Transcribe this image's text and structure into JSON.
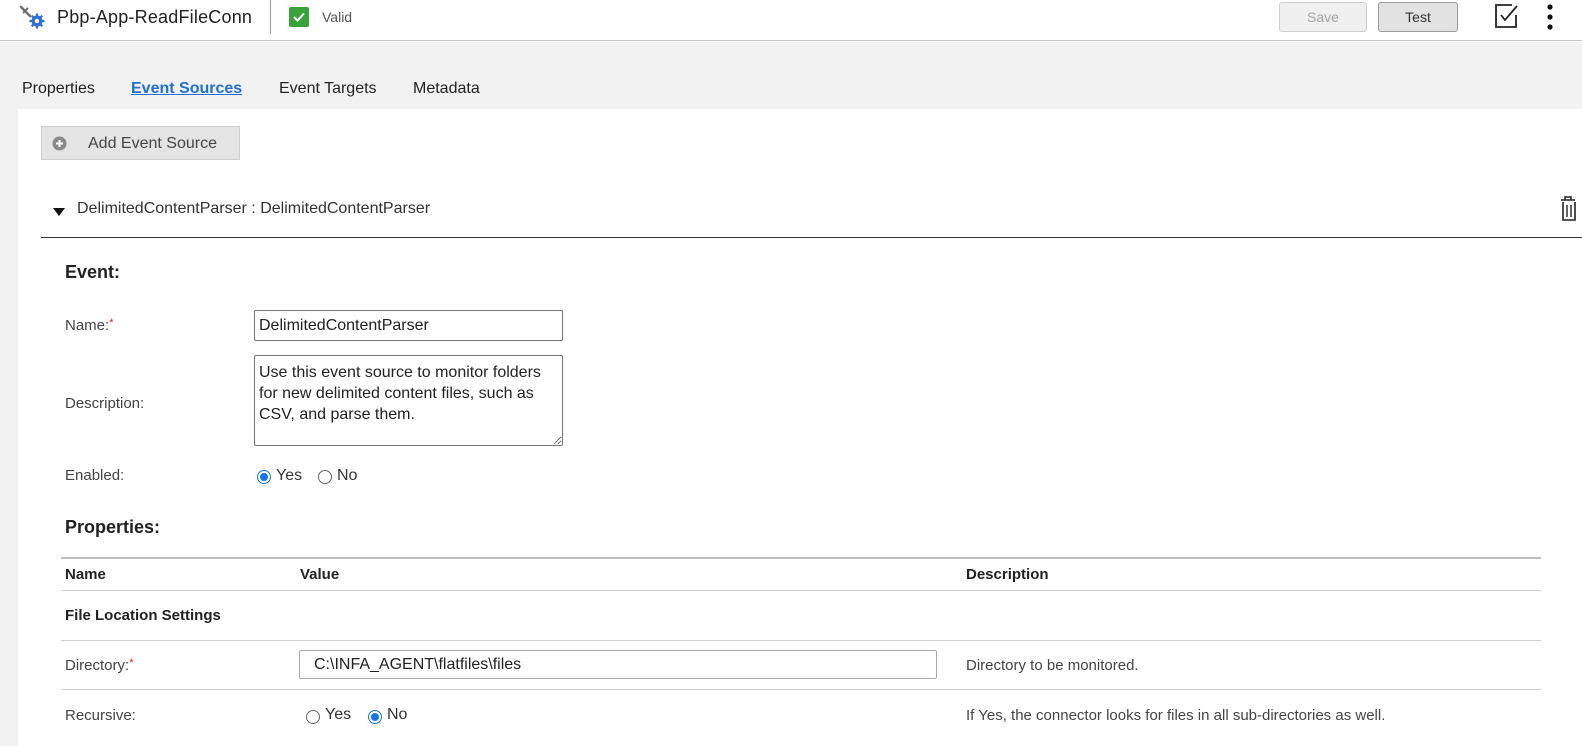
{
  "header": {
    "app_title": "Pbp-App-ReadFileConn",
    "status_text": "Valid",
    "save_label": "Save",
    "test_label": "Test"
  },
  "tabs": [
    {
      "label": "Properties",
      "active": false
    },
    {
      "label": "Event Sources",
      "active": true
    },
    {
      "label": "Event Targets",
      "active": false
    },
    {
      "label": "Metadata",
      "active": false
    }
  ],
  "toolbar": {
    "add_event_source_label": "Add Event Source"
  },
  "event_source": {
    "title": "DelimitedContentParser : DelimitedContentParser",
    "event_heading": "Event:",
    "name_label": "Name:",
    "name_value": "DelimitedContentParser",
    "description_label": "Description:",
    "description_value": "Use this event source to monitor folders for new delimited content files, such as CSV, and parse them.",
    "enabled_label": "Enabled:",
    "enabled_options": [
      "Yes",
      "No"
    ],
    "enabled_selected": "Yes"
  },
  "properties": {
    "heading": "Properties:",
    "columns": [
      "Name",
      "Value",
      "Description"
    ],
    "group_title": "File Location Settings",
    "rows": [
      {
        "name": "Directory:",
        "required": true,
        "value": "C:\\INFA_AGENT\\flatfiles\\files",
        "description": "Directory to be monitored."
      },
      {
        "name": "Recursive:",
        "required": false,
        "options": [
          "Yes",
          "No"
        ],
        "selected": "No",
        "description": "If Yes, the connector looks for files in all sub-directories as well."
      }
    ]
  },
  "colors": {
    "accent": "#1f6fd6",
    "valid_green": "#3aa23a",
    "required": "#dd2222"
  }
}
